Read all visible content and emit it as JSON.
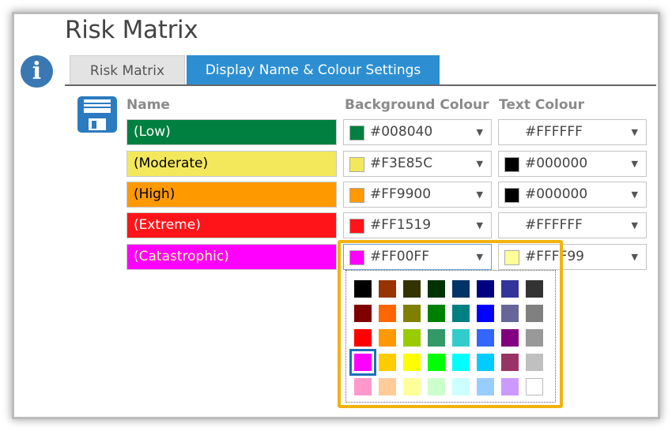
{
  "page_title": "Risk Matrix",
  "tabs": [
    {
      "label": "Risk Matrix",
      "active": false
    },
    {
      "label": "Display Name & Colour Settings",
      "active": true
    }
  ],
  "columns": {
    "name": "Name",
    "background": "Background Colour",
    "text": "Text Colour"
  },
  "rows": [
    {
      "name": "(Low)",
      "bg": "#008040",
      "text_color": "#FFFFFF",
      "bg_label": "#008040",
      "text_label": "#FFFFFF"
    },
    {
      "name": "(Moderate)",
      "bg": "#F3E85C",
      "text_color": "#000000",
      "bg_label": "#F3E85C",
      "text_label": "#000000"
    },
    {
      "name": "(High)",
      "bg": "#FF9900",
      "text_color": "#000000",
      "bg_label": "#FF9900",
      "text_label": "#000000"
    },
    {
      "name": "(Extreme)",
      "bg": "#FF1519",
      "text_color": "#FFFFFF",
      "bg_label": "#FF1519",
      "text_label": "#FFFFFF"
    },
    {
      "name": "(Catastrophic)",
      "bg": "#FF00FF",
      "text_color": "#FFFF99",
      "bg_label": "#FF00FF",
      "text_label": "#FFFF99"
    }
  ],
  "palette": {
    "selected": "#FF00FF",
    "rows": [
      [
        "#000000",
        "#993300",
        "#333300",
        "#003300",
        "#003366",
        "#000080",
        "#333399",
        "#333333"
      ],
      [
        "#800000",
        "#FF6600",
        "#808000",
        "#008000",
        "#008080",
        "#0000FF",
        "#666699",
        "#808080"
      ],
      [
        "#FF0000",
        "#FF9900",
        "#99CC00",
        "#339966",
        "#33CCCC",
        "#3366FF",
        "#800080",
        "#999999"
      ],
      [
        "#FF00FF",
        "#FFCC00",
        "#FFFF00",
        "#00FF00",
        "#00FFFF",
        "#00CCFF",
        "#993366",
        "#C0C0C0"
      ],
      [
        "#FF99CC",
        "#FFCC99",
        "#FFFF99",
        "#CCFFCC",
        "#CCFFFF",
        "#99CCFF",
        "#CC99FF",
        "#FFFFFF"
      ]
    ]
  },
  "icons": {
    "info": "info-icon",
    "save": "floppy-disk-icon",
    "dropdown": "caret-down-icon"
  },
  "accent_color": "#2D8FD2",
  "highlight_color": "#F2B20F"
}
